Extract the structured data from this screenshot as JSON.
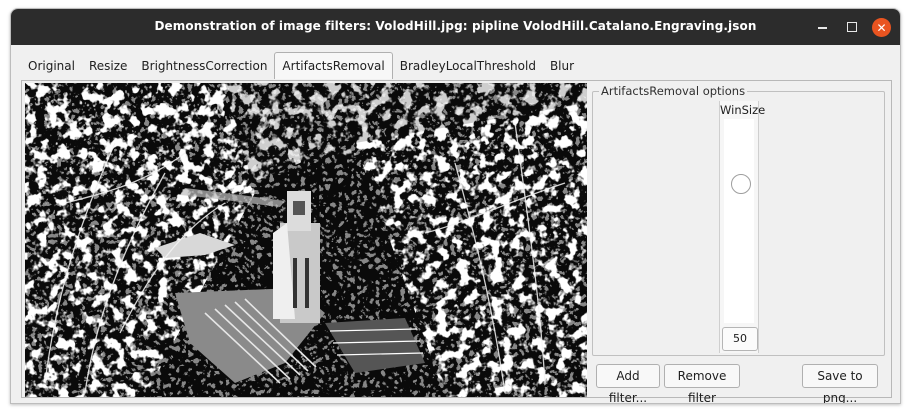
{
  "window": {
    "title": "Demonstration of image filters: VolodHill.jpg: pipline VolodHill.Catalano.Engraving.json"
  },
  "tabs": [
    {
      "label": "Original",
      "active": false
    },
    {
      "label": "Resize",
      "active": false
    },
    {
      "label": "BrightnessCorrection",
      "active": false
    },
    {
      "label": "ArtifactsRemoval",
      "active": true
    },
    {
      "label": "BradleyLocalThreshold",
      "active": false
    },
    {
      "label": "Blur",
      "active": false
    }
  ],
  "options": {
    "group_title": "ArtifactsRemoval options",
    "slider_label": "WinSize",
    "slider_value": "50",
    "slider_level": 0.7
  },
  "buttons": {
    "add_filter": "Add filter...",
    "remove_filter": "Remove filter",
    "save_png": "Save to png..."
  }
}
